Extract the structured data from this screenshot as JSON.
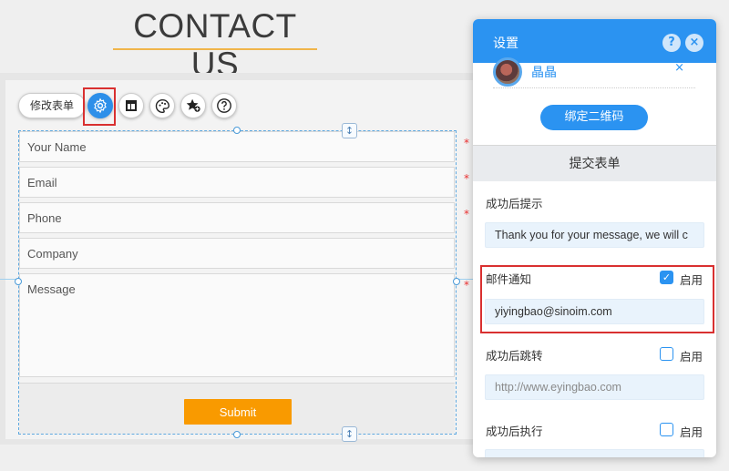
{
  "page": {
    "title": "CONTACT US"
  },
  "form": {
    "fields": [
      {
        "placeholder": "Your Name",
        "required": true
      },
      {
        "placeholder": "Email",
        "required": true
      },
      {
        "placeholder": "Phone",
        "required": true
      },
      {
        "placeholder": "Company",
        "required": false
      },
      {
        "placeholder": "Message",
        "required": true
      }
    ],
    "required_mark": "*",
    "submit_label": "Submit",
    "accent_color": "#f99a00"
  },
  "toolbar": {
    "edit_label": "修改表单",
    "buttons": [
      {
        "icon": "gear-icon",
        "active": true
      },
      {
        "icon": "layout-icon",
        "active": false
      },
      {
        "icon": "palette-icon",
        "active": false
      },
      {
        "icon": "star-add-icon",
        "active": false
      },
      {
        "icon": "help-icon",
        "active": false
      }
    ]
  },
  "panel": {
    "title": "设置",
    "help_icon": "?",
    "close_icon": "×",
    "account_name": "晶晶",
    "account_remove": "×",
    "bind_button": "绑定二维码",
    "section_title": "提交表单",
    "success_tip_label": "成功后提示",
    "success_tip_value": "Thank you for your message, we will c",
    "email_notice_label": "邮件通知",
    "email_notice_enabled": true,
    "enable_label": "启用",
    "email_value": "yiyingbao@sinoim.com",
    "redirect_label": "成功后跳转",
    "redirect_enabled": false,
    "redirect_placeholder": "http://www.eyingbao.com",
    "execute_label": "成功后执行",
    "execute_enabled": false,
    "accent_color": "#2b93f1"
  }
}
